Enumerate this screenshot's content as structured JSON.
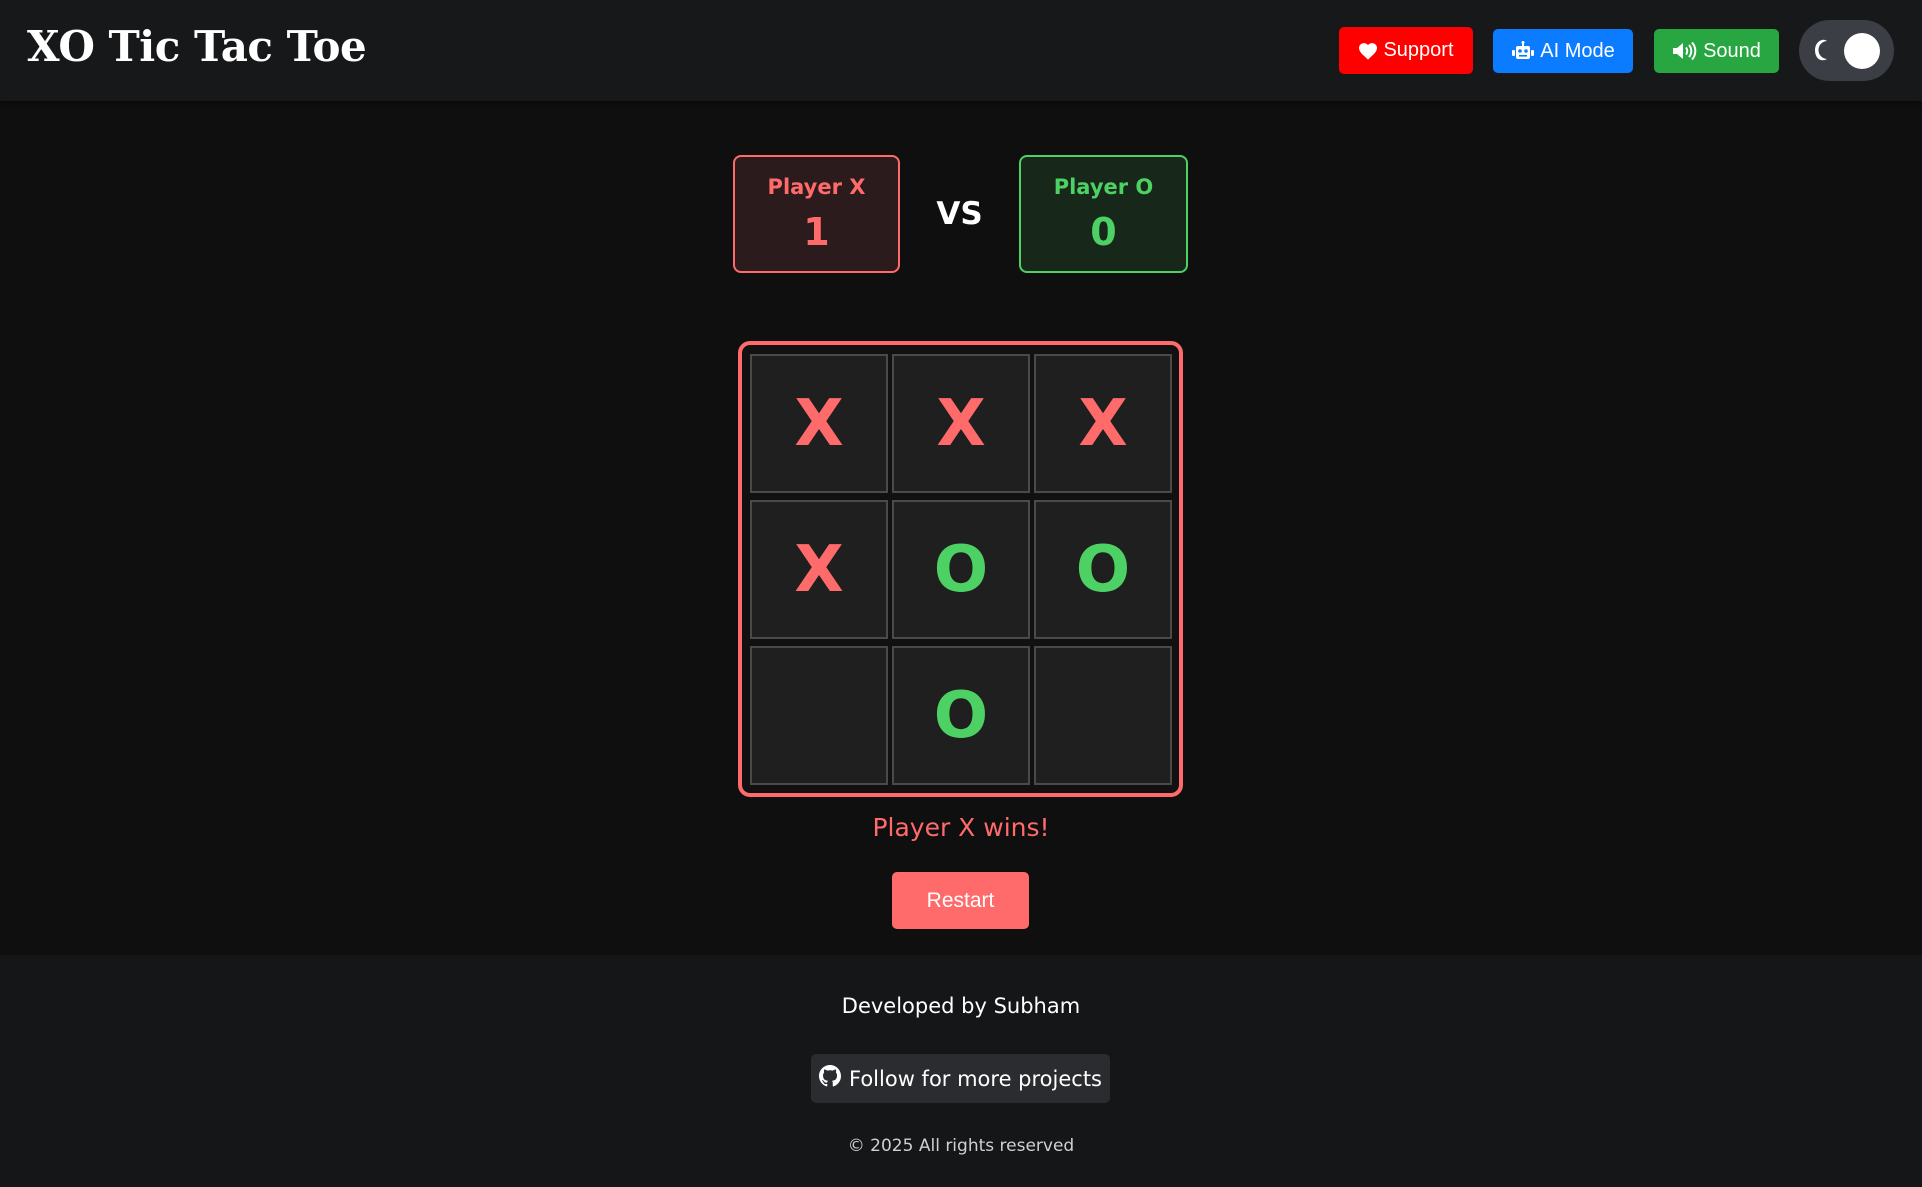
{
  "header": {
    "title": "XO Tic Tac Toe",
    "support_label": "Support",
    "ai_label": "AI Mode",
    "sound_label": "Sound",
    "theme_toggle": "dark"
  },
  "scoreboard": {
    "player_x": {
      "label": "Player X",
      "score": "1"
    },
    "vs": "VS",
    "player_o": {
      "label": "Player O",
      "score": "0"
    }
  },
  "board": {
    "cells": [
      "X",
      "X",
      "X",
      "X",
      "O",
      "O",
      "",
      "O",
      ""
    ]
  },
  "status": "Player X wins!",
  "restart_label": "Restart",
  "footer": {
    "developed_by": "Developed by Subham",
    "follow_label": "Follow for more projects",
    "copyright": "© 2025 All rights reserved"
  },
  "colors": {
    "x": "#ff6b6b",
    "o": "#4dd164",
    "support": "#ff0000",
    "ai_mode": "#0b7cff",
    "sound": "#27a641"
  },
  "icons": {
    "support": "heart-icon",
    "ai_mode": "robot-icon",
    "sound": "volume-icon",
    "theme": "moon-icon",
    "follow": "github-icon"
  }
}
